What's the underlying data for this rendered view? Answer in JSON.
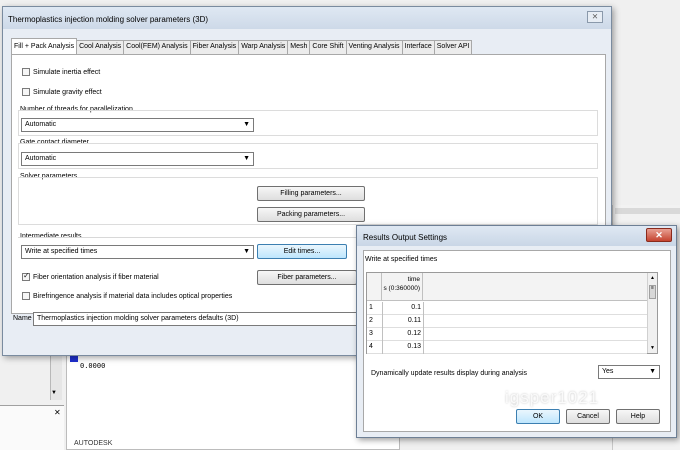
{
  "background": {
    "zero_readout": "0.0000",
    "vendor_label": "AUTODESK",
    "panel_close_icon": "x-icon"
  },
  "main_dialog": {
    "title": "Thermoplastics injection molding solver parameters (3D)",
    "close_label": "⨯",
    "tabs": [
      "Fill + Pack Analysis",
      "Cool Analysis",
      "Cool(FEM) Analysis",
      "Fiber Analysis",
      "Warp Analysis",
      "Mesh",
      "Core Shift",
      "Venting Analysis",
      "Interface",
      "Solver API"
    ],
    "active_tab": "Fill + Pack Analysis",
    "simulate_inertia": {
      "label": "Simulate inertia effect",
      "checked": false
    },
    "simulate_gravity": {
      "label": "Simulate gravity effect",
      "checked": false
    },
    "threads": {
      "label": "Number of threads for parallelization",
      "value": "Automatic"
    },
    "gate_contact": {
      "label": "Gate contact diameter",
      "value": "Automatic"
    },
    "solver_parameters": {
      "label": "Solver parameters",
      "filling_button": "Filling parameters...",
      "packing_button": "Packing parameters..."
    },
    "intermediate_results": {
      "label": "Intermediate results",
      "value": "Write at specified times",
      "edit_button": "Edit times..."
    },
    "fiber_orientation": {
      "label": "Fiber orientation analysis if fiber material",
      "checked": true
    },
    "fiber_button": "Fiber parameters...",
    "birefringence": {
      "label": "Birefringence analysis if material data includes optical properties",
      "checked": false
    },
    "name_label": "Name",
    "name_value": "Thermoplastics injection molding solver parameters defaults (3D)"
  },
  "results_dialog": {
    "title": "Results Output Settings",
    "close_label": "✕",
    "group_label": "Write at specified times",
    "column_header_line1": "time",
    "column_header_line2": "s (0:360000)",
    "rows": [
      {
        "index": "1",
        "value": "0.1"
      },
      {
        "index": "2",
        "value": "0.11"
      },
      {
        "index": "3",
        "value": "0.12"
      },
      {
        "index": "4",
        "value": "0.13"
      }
    ],
    "dynamic_update_label": "Dynamically update results display during analysis",
    "dynamic_update_value": "Yes",
    "ok_button": "OK",
    "cancel_button": "Cancel",
    "help_button": "Help"
  },
  "watermark": "igsper1021"
}
